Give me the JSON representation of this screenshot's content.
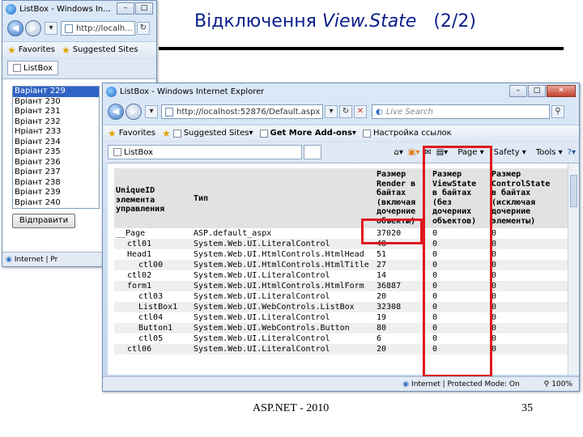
{
  "slide": {
    "title_prefix": "Відключення ",
    "title_italic": "View.State",
    "title_suffix": "   (2/2)",
    "footer": "ASP.NET - 2010",
    "page_number": "35"
  },
  "back_window": {
    "title": "ListBox - Windows In...",
    "address": "http://localh...",
    "favorites": "Favorites",
    "suggested": "Suggested Sites",
    "tab": "ListBox",
    "listbox_items": [
      "Варіант 229",
      "Вріант 230",
      "Вріант 231",
      "Вріант 232",
      "Нріант 233",
      "Вріант 234",
      "Вріант 235",
      "Вріант 236",
      "Вріант 237",
      "Вріант 238",
      "Вріант 239",
      "Вріант 240"
    ],
    "selected_index": 0,
    "submit_label": "Відправити",
    "status": "Internet | Pr"
  },
  "front_window": {
    "title": "ListBox - Windows Internet Explorer",
    "address": "http://localhost:52876/Default.aspx",
    "search_placeholder": "Live Search",
    "favorites": "Favorites",
    "suggested": "Suggested Sites",
    "addons": "Get More Add-ons",
    "links": "Настройка ссылок",
    "tab": "ListBox",
    "menu_page": "Page",
    "menu_safety": "Safety",
    "menu_tools": "Tools",
    "status_zone": "Internet | Protected Mode: On",
    "zoom": "100%"
  },
  "trace_table": {
    "headers": {
      "id": "UniqueID\nэлемента\nуправления",
      "type": "Тип",
      "render": "Размер\nRender в\nбайтах\n(включая\nдочерние\nобъекты)",
      "viewstate": "Размер\nViewState\nв байтах\n(без\nдочерних\nобъектов)",
      "controlstate": "Размер\nControlState\nв байтах\n(исключая\nдочерние\nэлементы)"
    },
    "rows": [
      {
        "id": "__Page",
        "indent": 0,
        "type": "ASP.default_aspx",
        "render": "37020",
        "viewstate": "0",
        "controlstate": "0"
      },
      {
        "id": "ctl01",
        "indent": 1,
        "type": "System.Web.UI.LiteralControl",
        "render": "48",
        "viewstate": "0",
        "controlstate": "0"
      },
      {
        "id": "Head1",
        "indent": 1,
        "type": "System.Web.UI.HtmlControls.HtmlHead",
        "render": "51",
        "viewstate": "0",
        "controlstate": "0"
      },
      {
        "id": "ctl00",
        "indent": 2,
        "type": "System.Web.UI.HtmlControls.HtmlTitle",
        "render": "27",
        "viewstate": "0",
        "controlstate": "0"
      },
      {
        "id": "ctl02",
        "indent": 1,
        "type": "System.Web.UI.LiteralControl",
        "render": "14",
        "viewstate": "0",
        "controlstate": "0"
      },
      {
        "id": "form1",
        "indent": 1,
        "type": "System.Web.UI.HtmlControls.HtmlForm",
        "render": "36887",
        "viewstate": "0",
        "controlstate": "0"
      },
      {
        "id": "ctl03",
        "indent": 2,
        "type": "System.Web.UI.LiteralControl",
        "render": "20",
        "viewstate": "0",
        "controlstate": "0"
      },
      {
        "id": "ListBox1",
        "indent": 2,
        "type": "System.Web.UI.WebControls.ListBox",
        "render": "32308",
        "viewstate": "0",
        "controlstate": "0"
      },
      {
        "id": "ctl04",
        "indent": 2,
        "type": "System.Web.UI.LiteralControl",
        "render": "19",
        "viewstate": "0",
        "controlstate": "0"
      },
      {
        "id": "Button1",
        "indent": 2,
        "type": "System.Web.UI.WebControls.Button",
        "render": "80",
        "viewstate": "0",
        "controlstate": "0"
      },
      {
        "id": "ctl05",
        "indent": 2,
        "type": "System.Web.UI.LiteralControl",
        "render": "6",
        "viewstate": "0",
        "controlstate": "0"
      },
      {
        "id": "ctl06",
        "indent": 1,
        "type": "System.Web.UI.LiteralControl",
        "render": "20",
        "viewstate": "0",
        "controlstate": "0"
      }
    ]
  },
  "colors": {
    "title": "#0b1f8c",
    "highlight_box": "#e0181f",
    "selection": "#3163c5"
  },
  "icons": {
    "back": "back-arrow-icon",
    "forward": "forward-arrow-icon",
    "favorites": "star-icon",
    "home": "home-icon",
    "help": "help-icon"
  }
}
